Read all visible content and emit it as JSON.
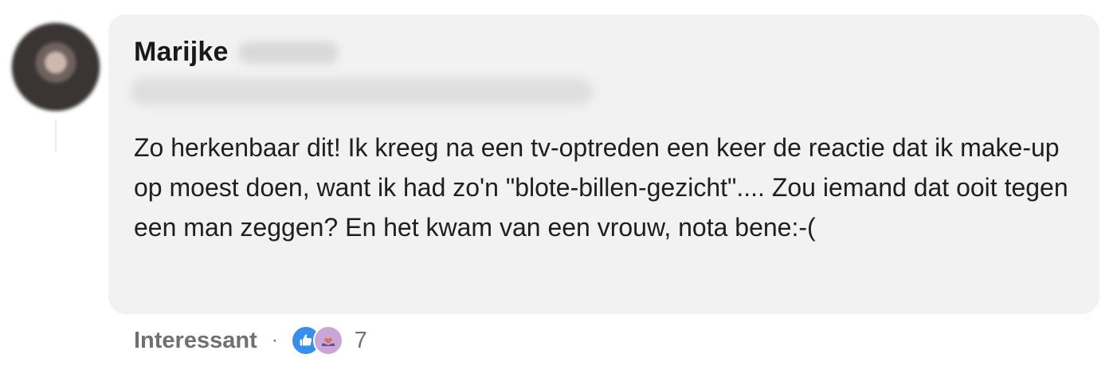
{
  "comment": {
    "author_first_name": "Marijke",
    "text": "Zo herkenbaar dit! Ik kreeg na een tv-optreden een keer de reactie dat ik make-up op moest doen, want ik had zo'n \"blote-billen-gezicht\".... Zou iemand dat ooit tegen een man zeggen? En het kwam van een vrouw, nota bene:-("
  },
  "reactions": {
    "label": "Interessant",
    "separator": "·",
    "count": "7",
    "icons": [
      "like-icon",
      "support-icon"
    ]
  },
  "colors": {
    "bubble_bg": "#f2f2f2",
    "like_icon": "#378fe9",
    "support_icon": "#c9a6d8",
    "meta_text": "#707070"
  }
}
